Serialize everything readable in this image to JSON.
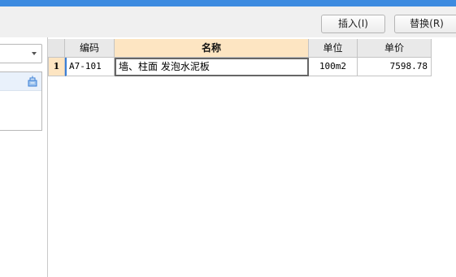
{
  "toolbar": {
    "insert_label": "插入(I)",
    "replace_label": "替换(R)"
  },
  "grid": {
    "columns": [
      "编码",
      "名称",
      "单位",
      "单价"
    ],
    "rows": [
      {
        "row_number": "1",
        "code": "A7-101",
        "name": "墙、柱面 发泡水泥板",
        "unit": "100m2",
        "price": "7598.78"
      }
    ]
  },
  "colors": {
    "title_bar": "#3d8be0",
    "header_highlight": "#fde5c2",
    "selection_border": "#3b7fd6"
  },
  "icons": {
    "tree_action": "tree-action-icon",
    "dropdown": "chevron-down-icon"
  }
}
